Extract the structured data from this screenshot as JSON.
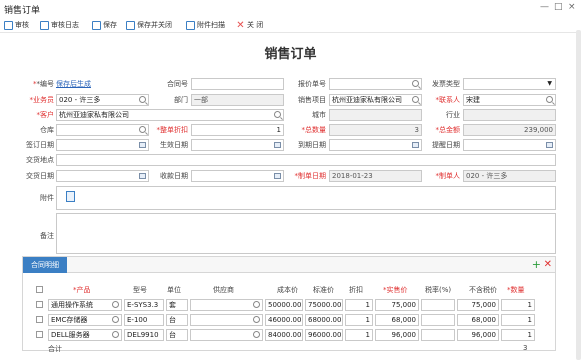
{
  "window": {
    "title": "销售订单",
    "minimize": "—",
    "maximize": "□",
    "close": "×"
  },
  "toolbar": {
    "audit": "审核",
    "audit_log": "审核日志",
    "save": "保存",
    "save_close": "保存并关闭",
    "attach_scan": "附件扫描",
    "close": "关 闭"
  },
  "page": {
    "heading": "销售订单"
  },
  "form": {
    "code_label": "*编号",
    "code_value": "保存后生成",
    "contract_label": "合同号",
    "contract_value": "",
    "quote_label": "报价单号",
    "quote_value": "",
    "invoice_type_label": "发票类型",
    "invoice_type_value": "",
    "salesman_label": "*业务员",
    "salesman_value": "020 - 许三多",
    "dept_label": "部门",
    "dept_value": "一部",
    "project_label": "销售项目",
    "project_value": "杭州亚迪家私有限公司",
    "contact_label": "*联系人",
    "contact_value": "宋建",
    "customer_label": "*客户",
    "customer_value": "杭州亚迪家私有限公司",
    "city_label": "城市",
    "city_value": "",
    "industry_label": "行业",
    "industry_value": "",
    "warehouse_label": "仓库",
    "warehouse_value": "",
    "discount_label": "*整单折扣",
    "discount_value": "1",
    "total_qty_label": "*总数量",
    "total_qty_value": "3",
    "total_amount_label": "*总金额",
    "total_amount_value": "239,000",
    "sign_date_label": "签订日期",
    "sign_date_value": "",
    "effective_date_label": "生效日期",
    "effective_date_value": "",
    "expire_date_label": "到期日期",
    "expire_date_value": "",
    "remind_date_label": "提醒日期",
    "remind_date_value": "",
    "delivery_addr_label": "交货地点",
    "delivery_addr_value": "",
    "delivery_date_label": "交货日期",
    "delivery_date_value": "",
    "receipt_date_label": "收款日期",
    "receipt_date_value": "",
    "created_date_label": "*制单日期",
    "created_date_value": "2018-01-23",
    "creator_label": "*制单人",
    "creator_value": "020 - 许三多",
    "attachment_label": "附件",
    "remark_label": "备注",
    "remark_value": ""
  },
  "details": {
    "tab": "合同明细",
    "headers": {
      "product": "*产品",
      "model": "型号",
      "unit": "单位",
      "supplier": "供应商",
      "cost": "成本价",
      "std_price": "标准价",
      "discount": "折扣",
      "price": "*实售价",
      "tax_rate": "税率(%)",
      "no_tax_price": "不含税价",
      "qty": "*数量"
    },
    "rows": [
      {
        "product": "通用操作系统",
        "model": "E-SYS3.3",
        "unit": "套",
        "supplier": "",
        "cost": "50000.00",
        "std": "75000.00",
        "discount": "1",
        "price": "75,000",
        "tax": "",
        "no_tax": "75,000",
        "qty": "1"
      },
      {
        "product": "EMC存储器",
        "model": "E-100",
        "unit": "台",
        "supplier": "",
        "cost": "46000.00",
        "std": "68000.00",
        "discount": "1",
        "price": "68,000",
        "tax": "",
        "no_tax": "68,000",
        "qty": "1"
      },
      {
        "product": "DELL服务器",
        "model": "DEL9910",
        "unit": "台",
        "supplier": "",
        "cost": "84000.00",
        "std": "96000.00",
        "discount": "1",
        "price": "96,000",
        "tax": "",
        "no_tax": "96,000",
        "qty": "1"
      }
    ],
    "total_label": "合计",
    "total_qty": "3"
  }
}
